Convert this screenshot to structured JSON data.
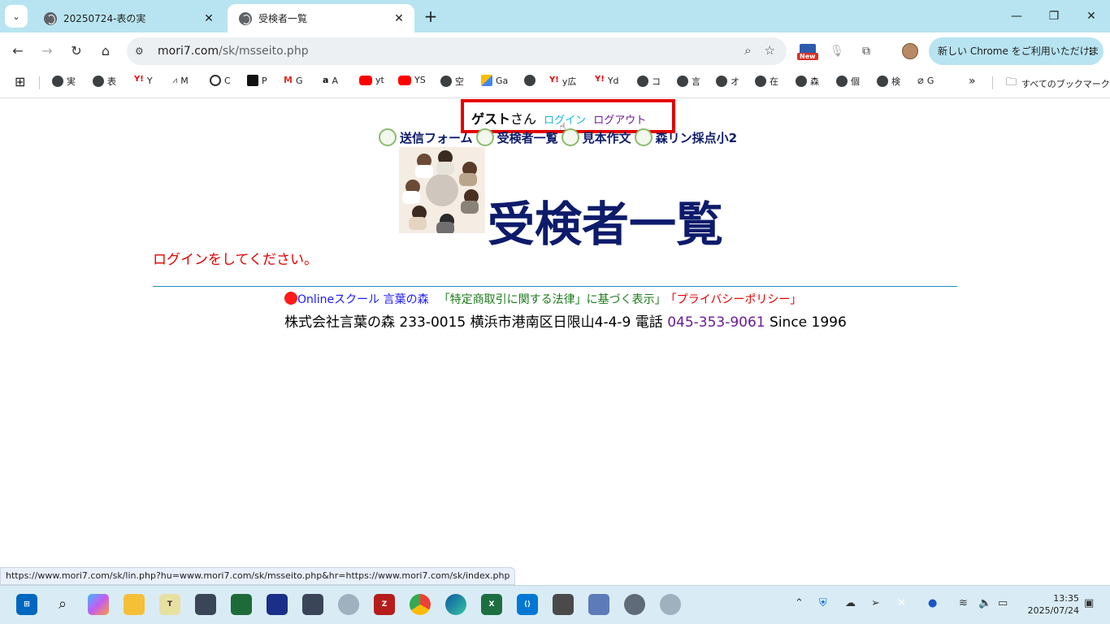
{
  "browser": {
    "tabs": [
      {
        "title": "20250724-表の実",
        "active": false
      },
      {
        "title": "受検者一覧",
        "active": true
      }
    ],
    "url_domain": "mori7.com",
    "url_path": "/sk/msseito.php",
    "new_badge": "New",
    "update_button": "新しい Chrome をご利用いただけます",
    "bookmarks": [
      "実",
      "表",
      "Y",
      "M",
      "C",
      "P",
      "G",
      "A",
      "yt",
      "YS",
      "空",
      "Ga",
      "",
      "y広",
      "Yd",
      "コ",
      "言",
      "オ",
      "在",
      "森",
      "個",
      "検",
      "G"
    ],
    "all_bookmarks": "すべてのブックマーク",
    "status_url": "https://www.mori7.com/sk/lin.php?hu=www.mori7.com/sk/msseito.php&hr=https://www.mori7.com/sk/index.php"
  },
  "page": {
    "guest_name": "ゲスト",
    "guest_suffix": "さん",
    "login_link": "ログイン",
    "logout_link": "ログアウト",
    "menu": [
      "送信フォーム",
      "受検者一覧",
      "見本作文",
      "森リン採点小2"
    ],
    "heading": "受検者一覧",
    "login_message": "ログインをしてください。",
    "footer_online": "Onlineスクール 言葉の森",
    "footer_tokushoho": "「特定商取引に関する法律」に基づく表示」",
    "footer_privacy": "「プライバシーポリシー」",
    "footer_company": "株式会社言葉の森 233-0015 横浜市港南区日限山4-4-9 電話 ",
    "footer_tel": "045-353-9061",
    "footer_since": " Since 1996"
  },
  "taskbar": {
    "time": "13:35",
    "date": "2025/07/24"
  },
  "colors": {
    "accent_navy": "#0d1b6b",
    "alert_red": "#e50000",
    "tabstrip": "#b8e4f1"
  }
}
